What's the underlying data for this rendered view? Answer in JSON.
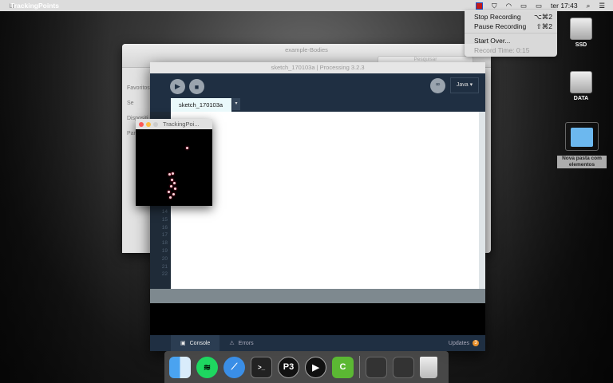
{
  "menubar": {
    "app_name": "TrackingPoints",
    "clock": "ter 17:43"
  },
  "record_menu": {
    "items": [
      {
        "label": "Stop Recording",
        "shortcut": "⌥⌘2"
      },
      {
        "label": "Pause Recording",
        "shortcut": "⇧⌘2"
      },
      {
        "label": "Start Over..."
      },
      {
        "label": "Record Time: 0:15"
      }
    ]
  },
  "desktop": {
    "icons": [
      "SSD",
      "DATA",
      "Nova pasta com elementos"
    ]
  },
  "finder": {
    "title": "example-Bodies",
    "search_placeholder": "Pesquisar",
    "sidebar": [
      "Favoritos",
      "Se",
      "Dispositi",
      "Par"
    ]
  },
  "processing": {
    "title": "sketch_170103a | Processing 3.2.3",
    "mode": "Java ▾",
    "tab": "sketch_170103a",
    "line_numbers": [
      "14",
      "15",
      "16",
      "17",
      "18",
      "19",
      "20",
      "21",
      "22"
    ],
    "console_tab": "Console",
    "errors_tab": "Errors",
    "updates": "Updates",
    "updates_count": "3"
  },
  "tracking_window": {
    "title": "TrackingPoi..."
  },
  "dock": {
    "apps": [
      "Finder",
      "Spotify",
      "Safari",
      "Terminal",
      "Processing",
      "Player",
      "Camtasia"
    ],
    "trash": "Trash"
  }
}
